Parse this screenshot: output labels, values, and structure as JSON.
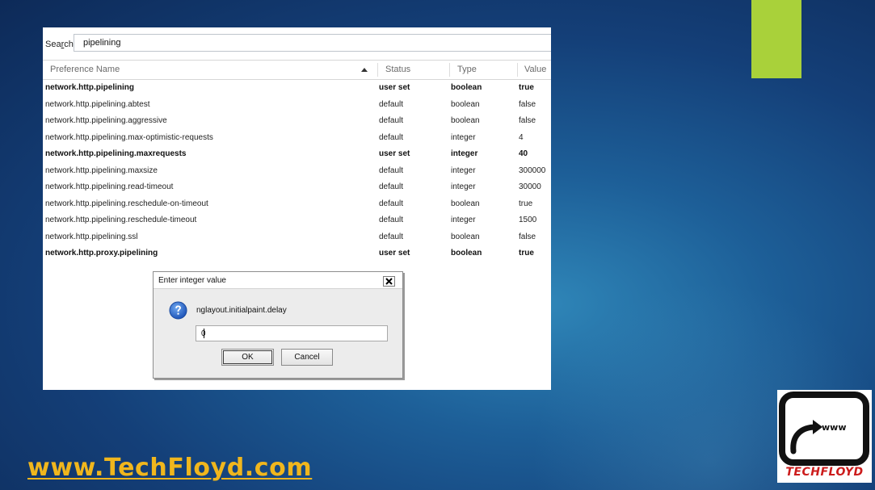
{
  "search": {
    "label_prefix": "Sea",
    "label_underlined": "r",
    "label_suffix": "ch:",
    "value": "pipelining"
  },
  "columns": {
    "name": "Preference Name",
    "status": "Status",
    "type": "Type",
    "value": "Value"
  },
  "rows": [
    {
      "name": "network.http.pipelining",
      "status": "user set",
      "type": "boolean",
      "value": "true",
      "bold": true
    },
    {
      "name": "network.http.pipelining.abtest",
      "status": "default",
      "type": "boolean",
      "value": "false",
      "bold": false
    },
    {
      "name": "network.http.pipelining.aggressive",
      "status": "default",
      "type": "boolean",
      "value": "false",
      "bold": false
    },
    {
      "name": "network.http.pipelining.max-optimistic-requests",
      "status": "default",
      "type": "integer",
      "value": "4",
      "bold": false
    },
    {
      "name": "network.http.pipelining.maxrequests",
      "status": "user set",
      "type": "integer",
      "value": "40",
      "bold": true
    },
    {
      "name": "network.http.pipelining.maxsize",
      "status": "default",
      "type": "integer",
      "value": "300000",
      "bold": false
    },
    {
      "name": "network.http.pipelining.read-timeout",
      "status": "default",
      "type": "integer",
      "value": "30000",
      "bold": false
    },
    {
      "name": "network.http.pipelining.reschedule-on-timeout",
      "status": "default",
      "type": "boolean",
      "value": "true",
      "bold": false
    },
    {
      "name": "network.http.pipelining.reschedule-timeout",
      "status": "default",
      "type": "integer",
      "value": "1500",
      "bold": false
    },
    {
      "name": "network.http.pipelining.ssl",
      "status": "default",
      "type": "boolean",
      "value": "false",
      "bold": false
    },
    {
      "name": "network.http.proxy.pipelining",
      "status": "user set",
      "type": "boolean",
      "value": "true",
      "bold": true
    }
  ],
  "dialog": {
    "title": "Enter integer value",
    "message": "nglayout.initialpaint.delay",
    "input_value": "0",
    "ok_label": "OK",
    "cancel_label": "Cancel",
    "icon": "question-icon"
  },
  "branding": {
    "site_url": "www.TechFloyd.com",
    "logo_www": "www",
    "logo_name": "TECHFLOYD",
    "accent_color": "#a9d13a",
    "url_color": "#f0b61d",
    "logo_text_color": "#cc1c1c"
  }
}
